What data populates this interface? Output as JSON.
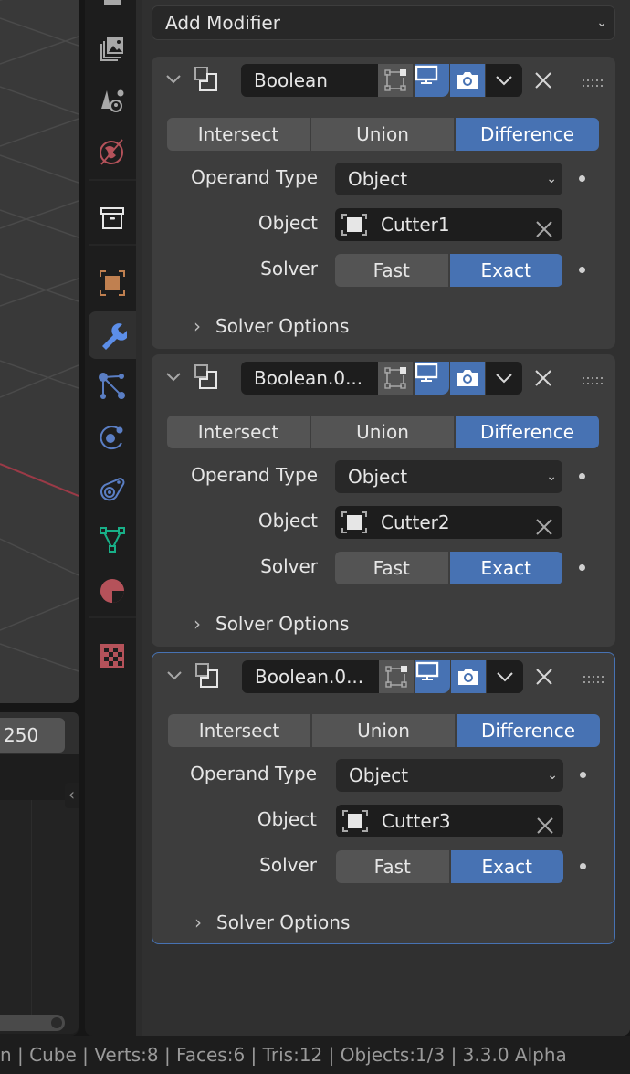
{
  "timeline": {
    "end_frame": "250"
  },
  "tabs": [
    {
      "name": "tab-render",
      "icon": "render-icon",
      "active": false
    },
    {
      "name": "tab-output",
      "icon": "output-icon",
      "active": false
    },
    {
      "name": "tab-view-layer",
      "icon": "view-layer-icon",
      "active": false
    },
    {
      "name": "tab-scene",
      "icon": "scene-icon",
      "active": false
    },
    {
      "name": "tab-world",
      "icon": "world-icon",
      "active": false
    },
    {
      "name": "tab-collection",
      "icon": "collection-icon",
      "active": false
    },
    {
      "name": "tab-object",
      "icon": "object-icon",
      "active": false
    },
    {
      "name": "tab-modifiers",
      "icon": "wrench-icon",
      "active": true
    },
    {
      "name": "tab-particles",
      "icon": "particles-icon",
      "active": false
    },
    {
      "name": "tab-physics",
      "icon": "physics-icon",
      "active": false
    },
    {
      "name": "tab-constraints",
      "icon": "constraints-icon",
      "active": false
    },
    {
      "name": "tab-data",
      "icon": "mesh-data-icon",
      "active": false
    },
    {
      "name": "tab-material",
      "icon": "material-icon",
      "active": false
    },
    {
      "name": "tab-texture",
      "icon": "texture-icon",
      "active": false
    }
  ],
  "add_modifier": {
    "label": "Add Modifier"
  },
  "modifiers": [
    {
      "name": "Boolean",
      "operations": [
        "Intersect",
        "Union",
        "Difference"
      ],
      "operation_selected": "Difference",
      "operand_type_label": "Operand Type",
      "operand_type_value": "Object",
      "object_label": "Object",
      "object_value": "Cutter1",
      "solver_label": "Solver",
      "solver_options": [
        "Fast",
        "Exact"
      ],
      "solver_selected": "Exact",
      "subpanel": "Solver Options",
      "active": false
    },
    {
      "name": "Boolean.0...",
      "operations": [
        "Intersect",
        "Union",
        "Difference"
      ],
      "operation_selected": "Difference",
      "operand_type_label": "Operand Type",
      "operand_type_value": "Object",
      "object_label": "Object",
      "object_value": "Cutter2",
      "solver_label": "Solver",
      "solver_options": [
        "Fast",
        "Exact"
      ],
      "solver_selected": "Exact",
      "subpanel": "Solver Options",
      "active": false
    },
    {
      "name": "Boolean.0...",
      "operations": [
        "Intersect",
        "Union",
        "Difference"
      ],
      "operation_selected": "Difference",
      "operand_type_label": "Operand Type",
      "operand_type_value": "Object",
      "object_label": "Object",
      "object_value": "Cutter3",
      "solver_label": "Solver",
      "solver_options": [
        "Fast",
        "Exact"
      ],
      "solver_selected": "Exact",
      "subpanel": "Solver Options",
      "active": true
    }
  ],
  "colors": {
    "accent": "#4772b3",
    "panel": "#3d3d3d",
    "field": "#1d1d1d",
    "button": "#545454"
  },
  "statusbar": {
    "text": "n | Cube | Verts:8 | Faces:6 | Tris:12 | Objects:1/3 | 3.3.0 Alpha"
  }
}
